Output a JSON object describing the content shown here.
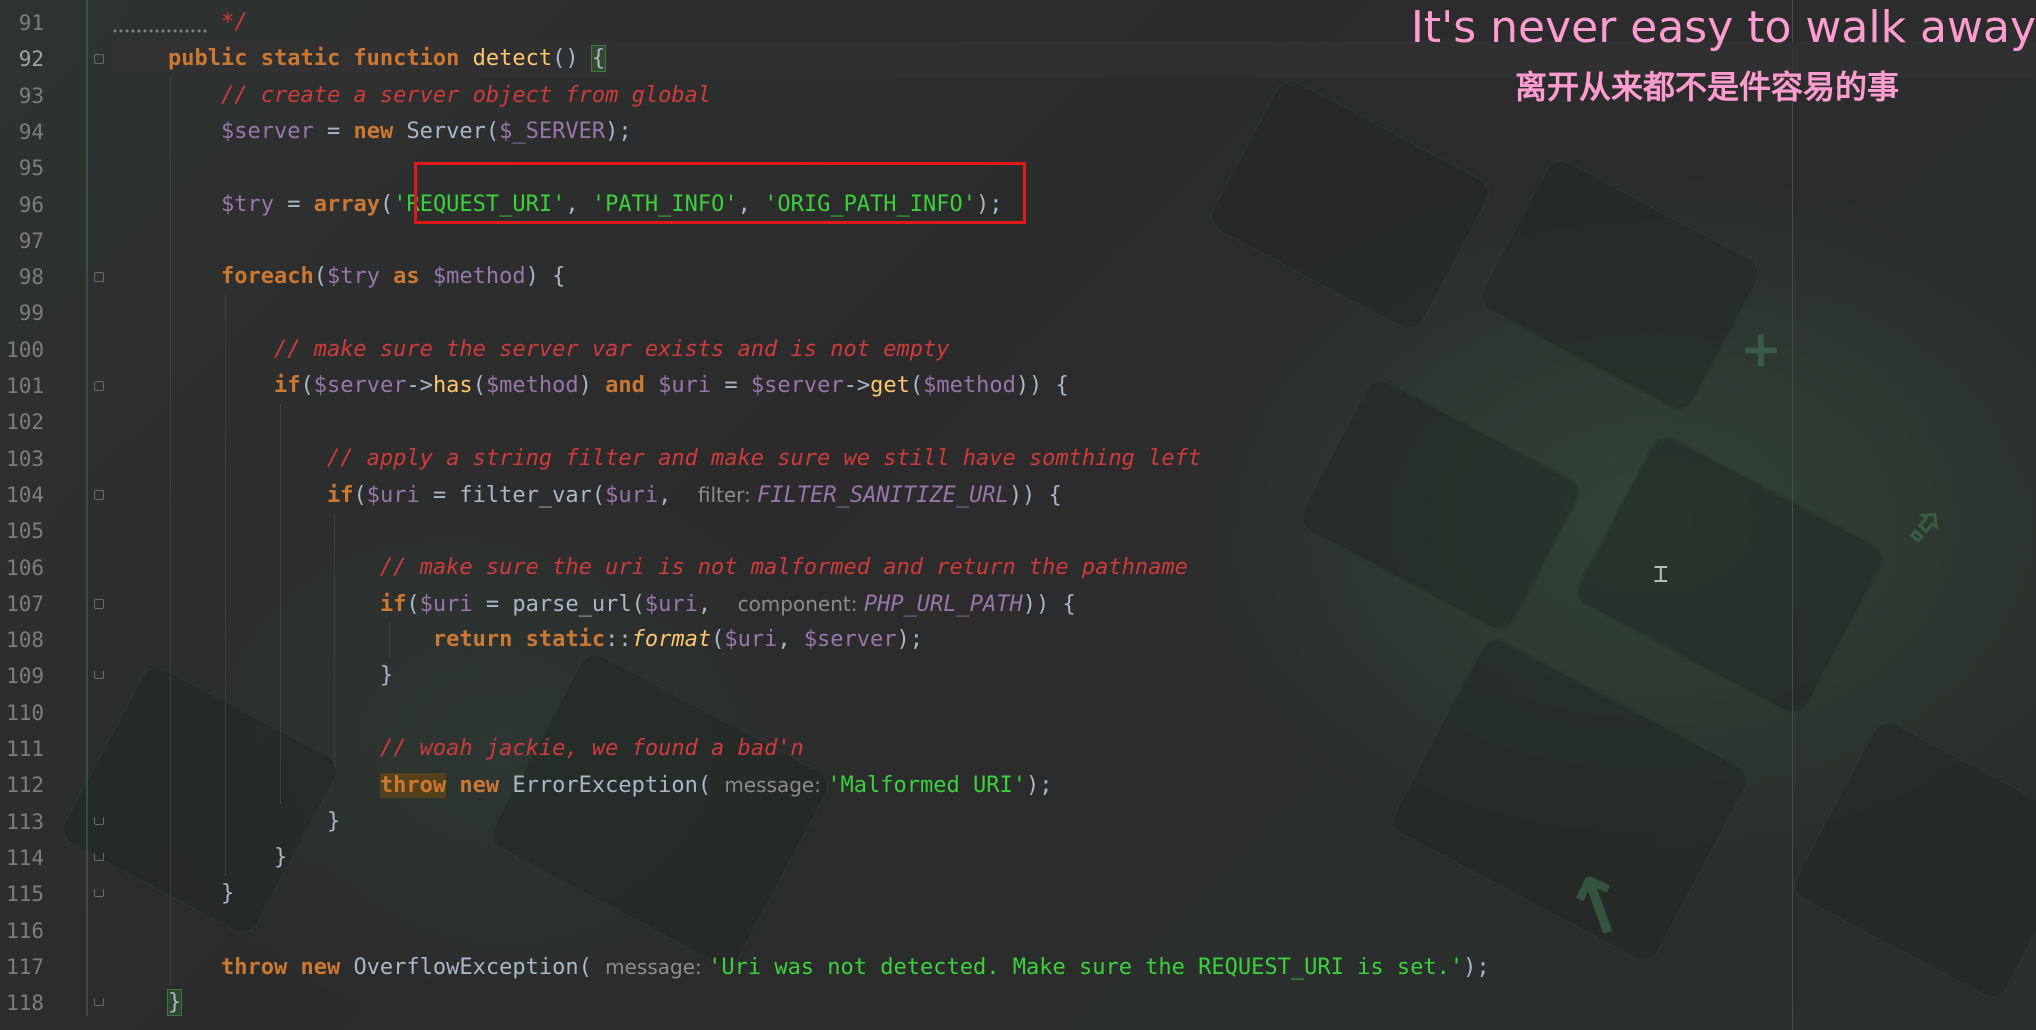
{
  "overlay": {
    "title_en": "It's never easy to walk away",
    "title_zh": "离开从来都不是件容易的事"
  },
  "lines": [
    {
      "num": "91",
      "parts": [
        [
          "cmt",
          "    */"
        ]
      ]
    },
    {
      "num": "92",
      "parts": [
        [
          "kw",
          "public static function "
        ],
        [
          "fn",
          "detect"
        ],
        [
          "plain",
          "() "
        ],
        [
          "bracket",
          "{"
        ]
      ]
    },
    {
      "num": "93",
      "parts": [
        [
          "cmt",
          "    // create a server object from global"
        ]
      ]
    },
    {
      "num": "94",
      "parts": [
        [
          "plain",
          "    "
        ],
        [
          "var",
          "$server"
        ],
        [
          "plain",
          " = "
        ],
        [
          "kw",
          "new "
        ],
        [
          "cls",
          "Server("
        ],
        [
          "var",
          "$_SERVER"
        ],
        [
          "plain",
          ");"
        ]
      ]
    },
    {
      "num": "95",
      "parts": []
    },
    {
      "num": "96",
      "parts": [
        [
          "plain",
          "    "
        ],
        [
          "var",
          "$try"
        ],
        [
          "plain",
          " = "
        ],
        [
          "kw",
          "array"
        ],
        [
          "plain",
          "("
        ],
        [
          "strg",
          "'REQUEST_URI'"
        ],
        [
          "plain",
          ", "
        ],
        [
          "strg",
          "'PATH_INFO'"
        ],
        [
          "plain",
          ", "
        ],
        [
          "strg",
          "'ORIG_PATH_INFO'"
        ],
        [
          "plain",
          ");"
        ]
      ]
    },
    {
      "num": "97",
      "parts": []
    },
    {
      "num": "98",
      "parts": [
        [
          "plain",
          "    "
        ],
        [
          "kw",
          "foreach"
        ],
        [
          "plain",
          "("
        ],
        [
          "var",
          "$try"
        ],
        [
          "kw",
          " as "
        ],
        [
          "var",
          "$method"
        ],
        [
          "plain",
          ") {"
        ]
      ]
    },
    {
      "num": "99",
      "parts": []
    },
    {
      "num": "100",
      "parts": [
        [
          "cmt",
          "        // make sure the server var exists and is not empty"
        ]
      ]
    },
    {
      "num": "101",
      "parts": [
        [
          "plain",
          "        "
        ],
        [
          "kw",
          "if"
        ],
        [
          "plain",
          "("
        ],
        [
          "var",
          "$server"
        ],
        [
          "plain",
          "->"
        ],
        [
          "fn",
          "has"
        ],
        [
          "plain",
          "("
        ],
        [
          "var",
          "$method"
        ],
        [
          "plain",
          ") "
        ],
        [
          "kw",
          "and "
        ],
        [
          "var",
          "$uri"
        ],
        [
          "plain",
          " = "
        ],
        [
          "var",
          "$server"
        ],
        [
          "plain",
          "->"
        ],
        [
          "fn",
          "get"
        ],
        [
          "plain",
          "("
        ],
        [
          "var",
          "$method"
        ],
        [
          "plain",
          ")) {"
        ]
      ]
    },
    {
      "num": "102",
      "parts": []
    },
    {
      "num": "103",
      "parts": [
        [
          "cmt",
          "            // apply a string filter and make sure we still have somthing left"
        ]
      ]
    },
    {
      "num": "104",
      "parts": [
        [
          "plain",
          "            "
        ],
        [
          "kw",
          "if"
        ],
        [
          "plain",
          "("
        ],
        [
          "var",
          "$uri"
        ],
        [
          "plain",
          " = filter_var("
        ],
        [
          "var",
          "$uri"
        ],
        [
          "plain",
          ",  "
        ],
        [
          "hint",
          "filter: "
        ],
        [
          "const",
          "FILTER_SANITIZE_URL"
        ],
        [
          "plain",
          ")) {"
        ]
      ]
    },
    {
      "num": "105",
      "parts": []
    },
    {
      "num": "106",
      "parts": [
        [
          "cmt",
          "                // make sure the uri is not malformed and return the pathname"
        ]
      ]
    },
    {
      "num": "107",
      "parts": [
        [
          "plain",
          "                "
        ],
        [
          "kw",
          "if"
        ],
        [
          "plain",
          "("
        ],
        [
          "var",
          "$uri"
        ],
        [
          "plain",
          " = parse_url("
        ],
        [
          "var",
          "$uri"
        ],
        [
          "plain",
          ",  "
        ],
        [
          "hint",
          "component: "
        ],
        [
          "const",
          "PHP_URL_PATH"
        ],
        [
          "plain",
          ")) {"
        ]
      ]
    },
    {
      "num": "108",
      "parts": [
        [
          "plain",
          "                    "
        ],
        [
          "kw",
          "return static"
        ],
        [
          "plain",
          "::"
        ],
        [
          "fnit",
          "format"
        ],
        [
          "plain",
          "("
        ],
        [
          "var",
          "$uri"
        ],
        [
          "plain",
          ", "
        ],
        [
          "var",
          "$server"
        ],
        [
          "plain",
          ");"
        ]
      ]
    },
    {
      "num": "109",
      "parts": [
        [
          "plain",
          "                }"
        ]
      ]
    },
    {
      "num": "110",
      "parts": []
    },
    {
      "num": "111",
      "parts": [
        [
          "cmt",
          "                // woah jackie, we found a bad'n"
        ]
      ]
    },
    {
      "num": "112",
      "parts": [
        [
          "plain",
          "                "
        ],
        [
          "throwhl",
          "throw"
        ],
        [
          "kw",
          " new "
        ],
        [
          "cls",
          "ErrorException( "
        ],
        [
          "hint",
          "message: "
        ],
        [
          "strg",
          "'Malformed URI'"
        ],
        [
          "plain",
          ");"
        ]
      ]
    },
    {
      "num": "113",
      "parts": [
        [
          "plain",
          "            }"
        ]
      ]
    },
    {
      "num": "114",
      "parts": [
        [
          "plain",
          "        }"
        ]
      ]
    },
    {
      "num": "115",
      "parts": [
        [
          "plain",
          "    }"
        ]
      ]
    },
    {
      "num": "116",
      "parts": []
    },
    {
      "num": "117",
      "parts": [
        [
          "plain",
          "    "
        ],
        [
          "kw",
          "throw new "
        ],
        [
          "cls",
          "OverflowException( "
        ],
        [
          "hint",
          "message: "
        ],
        [
          "strg",
          "'Uri was not detected. Make sure the REQUEST_URI is set.'"
        ],
        [
          "plain",
          ");"
        ]
      ]
    },
    {
      "num": "118",
      "parts": [
        [
          "bracket",
          "}"
        ]
      ]
    }
  ],
  "colors": {
    "background": "#2b2b2b",
    "keyword": "#cc7832",
    "variable": "#9876aa",
    "string": "#3bd13b",
    "comment": "#cf3a3a",
    "overlay_text": "#ff9ccf",
    "highlight_box": "#e01a1a"
  }
}
